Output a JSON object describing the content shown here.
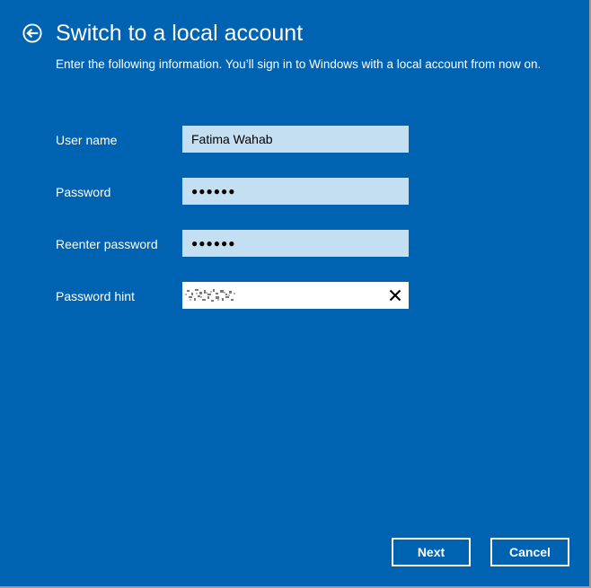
{
  "header": {
    "title": "Switch to a local account",
    "subtitle": "Enter the following information. You’ll sign in to Windows with a local account from now on."
  },
  "form": {
    "username": {
      "label": "User name",
      "value": "Fatima Wahab"
    },
    "password": {
      "label": "Password",
      "value": "●●●●●●"
    },
    "reenter_password": {
      "label": "Reenter password",
      "value": "●●●●●●"
    },
    "password_hint": {
      "label": "Password hint",
      "value_redacted": true
    }
  },
  "buttons": {
    "next_label": "Next",
    "cancel_label": "Cancel"
  },
  "icons": {
    "back": "back-arrow-circle-icon",
    "clear": "close-icon"
  },
  "colors": {
    "background": "#0063b1",
    "field": "#c5dff2",
    "text": "#ffffff"
  }
}
